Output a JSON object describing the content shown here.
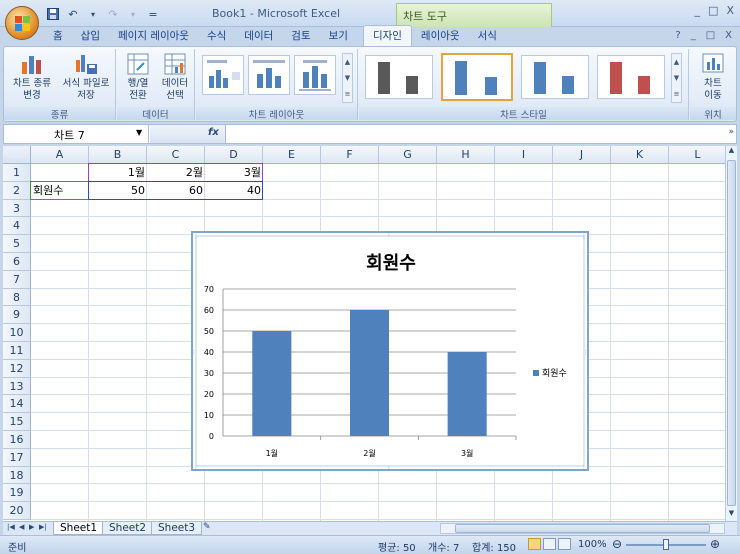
{
  "window": {
    "title": "Book1 - Microsoft Excel",
    "context_tools": "차트 도구",
    "controls": [
      "_",
      "□",
      "X"
    ]
  },
  "qat": {
    "customize": "="
  },
  "tabs": [
    {
      "label": "홈",
      "active": false
    },
    {
      "label": "삽입",
      "active": false
    },
    {
      "label": "페이지 레이아웃",
      "active": false
    },
    {
      "label": "수식",
      "active": false
    },
    {
      "label": "데이터",
      "active": false
    },
    {
      "label": "검토",
      "active": false
    },
    {
      "label": "보기",
      "active": false
    },
    {
      "label": "디자인",
      "active": true
    },
    {
      "label": "레이아웃",
      "active": false
    },
    {
      "label": "서식",
      "active": false
    }
  ],
  "ribbon_right": [
    "?",
    "_",
    "□",
    "X"
  ],
  "ribbon": {
    "groups": {
      "type": {
        "label": "종류",
        "buttons": [
          "차트 종류\n변경",
          "서식 파일로\n저장"
        ]
      },
      "data": {
        "label": "데이터",
        "buttons": [
          "행/열\n전환",
          "데이터\n선택"
        ]
      },
      "layouts": {
        "label": "차트 레이아웃"
      },
      "styles": {
        "label": "차트 스타일"
      },
      "location": {
        "label": "위치",
        "buttons": [
          "차트\n이동"
        ]
      }
    }
  },
  "formula_bar": {
    "name_box": "차트 7",
    "fx": "fx",
    "formula": ""
  },
  "sheet": {
    "columns": [
      "A",
      "B",
      "C",
      "D",
      "E",
      "F",
      "G",
      "H",
      "I",
      "J",
      "K",
      "L"
    ],
    "rows": [
      "1",
      "2",
      "3",
      "4",
      "5",
      "6",
      "7",
      "8",
      "9",
      "10",
      "11",
      "12",
      "13",
      "14",
      "15",
      "16",
      "17",
      "18",
      "19",
      "20"
    ],
    "cells": {
      "B1": "1월",
      "C1": "2월",
      "D1": "3월",
      "A2": "회원수",
      "B2": "50",
      "C2": "60",
      "D2": "40"
    }
  },
  "chart_data": {
    "type": "bar",
    "title": "회원수",
    "categories": [
      "1월",
      "2월",
      "3월"
    ],
    "series": [
      {
        "name": "회원수",
        "values": [
          50,
          60,
          40
        ],
        "color": "#4f81bd"
      }
    ],
    "yticks": [
      "0",
      "10",
      "20",
      "30",
      "40",
      "50",
      "60",
      "70"
    ],
    "ylim": [
      0,
      70
    ],
    "grid": true,
    "legend": "right"
  },
  "sheet_tabs": [
    {
      "label": "Sheet1",
      "active": true
    },
    {
      "label": "Sheet2",
      "active": false
    },
    {
      "label": "Sheet3",
      "active": false
    }
  ],
  "status": {
    "ready": "준비",
    "average": "평균: 50",
    "count": "개수: 7",
    "sum": "합계: 150",
    "zoom": "100%"
  },
  "colors": {
    "accent": "#4f81bd",
    "ribbon_border": "#a7bfdd",
    "style_dark": "#595959",
    "style_red": "#c0504d"
  }
}
